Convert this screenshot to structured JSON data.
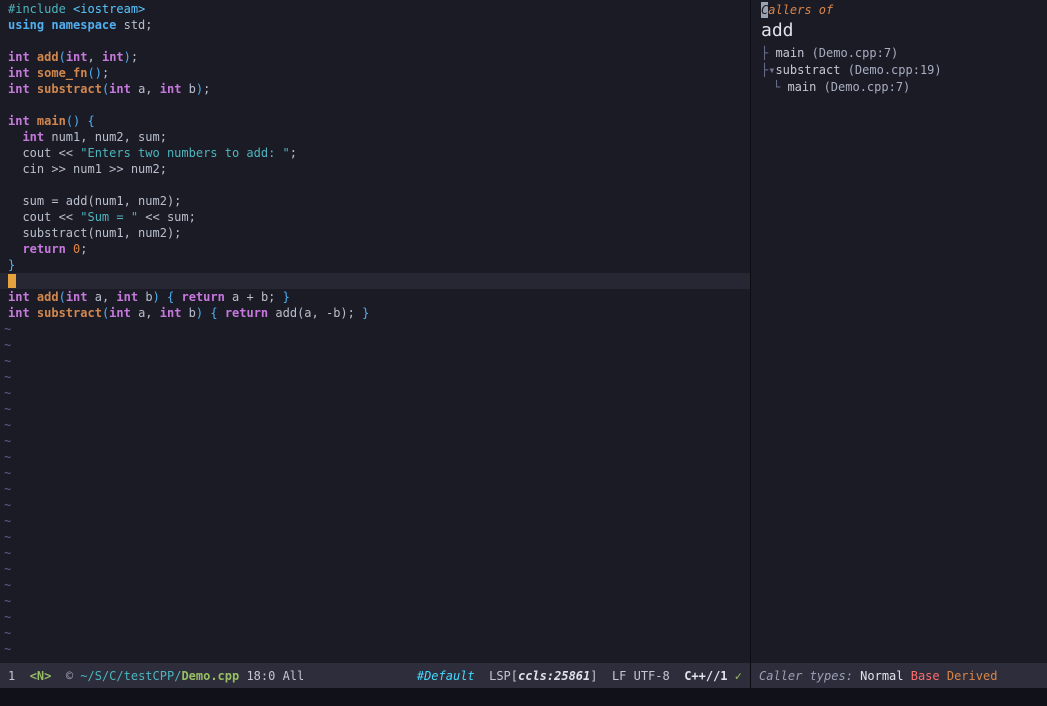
{
  "palette": {
    "bg": "#1b1b26",
    "fg": "#b8bfcc",
    "bright": "#dfe3ea",
    "purple": "#c678dd",
    "orange": "#d2874d",
    "orangenum": "#da8548",
    "blue": "#51afef",
    "teal": "#4db5bd",
    "cyanl": "#57c7ff",
    "cyan": "#46d9ff",
    "green": "#98be65",
    "red": "#ff6c6b",
    "tilde": "#565d84",
    "cursor": "#e6a23c",
    "cursorline": "#272734",
    "slbg": "#2d2d3b",
    "slfg": "#c2c7d0",
    "slicon": "#9aa0ae",
    "sllabel": "#9ba0b5",
    "title": "#da8548",
    "panelcursor": "#9aa1b0",
    "treeglyph": "#6d7390",
    "treetext": "#c3c8d2",
    "treeloc": "#a7adc0",
    "sep": "#0c0c13",
    "cmdbg": "#11111a"
  },
  "editor": {
    "cursor": {
      "line": 17,
      "col": 0,
      "position_label": "18:0"
    },
    "filler_char": "~",
    "filler_count": 21,
    "lines": [
      [
        [
          "pre",
          "#include "
        ],
        [
          "inc",
          "<iostream>"
        ]
      ],
      [
        [
          "ns",
          "using namespace"
        ],
        [
          "txt",
          " std;"
        ]
      ],
      [],
      [
        [
          "kw",
          "int "
        ],
        [
          "fn",
          "add"
        ],
        [
          "blue",
          "("
        ],
        [
          "kw",
          "int"
        ],
        [
          "txt",
          ", "
        ],
        [
          "kw",
          "int"
        ],
        [
          "blue",
          ")"
        ],
        [
          "txt",
          ";"
        ]
      ],
      [
        [
          "kw",
          "int "
        ],
        [
          "fn",
          "some_fn"
        ],
        [
          "blue",
          "()"
        ],
        [
          "txt",
          ";"
        ]
      ],
      [
        [
          "kw",
          "int "
        ],
        [
          "fn",
          "substract"
        ],
        [
          "blue",
          "("
        ],
        [
          "kw",
          "int"
        ],
        [
          "txt",
          " a, "
        ],
        [
          "kw",
          "int"
        ],
        [
          "txt",
          " b"
        ],
        [
          "blue",
          ")"
        ],
        [
          "txt",
          ";"
        ]
      ],
      [],
      [
        [
          "kw",
          "int "
        ],
        [
          "fn",
          "main"
        ],
        [
          "blue",
          "() {"
        ]
      ],
      [
        [
          "txt",
          "  "
        ],
        [
          "kw",
          "int "
        ],
        [
          "txt",
          "num1, num2, sum;"
        ]
      ],
      [
        [
          "txt",
          "  cout << "
        ],
        [
          "str",
          "\"Enters two numbers to add: \""
        ],
        [
          "txt",
          ";"
        ]
      ],
      [
        [
          "txt",
          "  cin >> num1 >> num2;"
        ]
      ],
      [],
      [
        [
          "txt",
          "  sum = add(num1, num2);"
        ]
      ],
      [
        [
          "txt",
          "  cout << "
        ],
        [
          "str",
          "\"Sum = \""
        ],
        [
          "txt",
          " << sum;"
        ]
      ],
      [
        [
          "txt",
          "  substract(num1, num2);"
        ]
      ],
      [
        [
          "txt",
          "  "
        ],
        [
          "kw",
          "return "
        ],
        [
          "num",
          "0"
        ],
        [
          "txt",
          ";"
        ]
      ],
      [
        [
          "blue",
          "}"
        ]
      ],
      [],
      [
        [
          "kw",
          "int "
        ],
        [
          "fn",
          "add"
        ],
        [
          "blue",
          "("
        ],
        [
          "kw",
          "int"
        ],
        [
          "txt",
          " a, "
        ],
        [
          "kw",
          "int"
        ],
        [
          "txt",
          " b"
        ],
        [
          "blue",
          ") { "
        ],
        [
          "kw",
          "return "
        ],
        [
          "txt",
          "a + b; "
        ],
        [
          "blue",
          "}"
        ]
      ],
      [
        [
          "kw",
          "int "
        ],
        [
          "fn",
          "substract"
        ],
        [
          "blue",
          "("
        ],
        [
          "kw",
          "int"
        ],
        [
          "txt",
          " a, "
        ],
        [
          "kw",
          "int"
        ],
        [
          "txt",
          " b"
        ],
        [
          "blue",
          ") { "
        ],
        [
          "kw",
          "return "
        ],
        [
          "txt",
          "add(a, -b); "
        ],
        [
          "blue",
          "}"
        ]
      ]
    ]
  },
  "panel": {
    "title_cursor_char": "C",
    "title_rest": "allers of",
    "symbol": "add",
    "tree": [
      {
        "glyph": "├ ",
        "name": "main",
        "loc": "(Demo.cpp:7)",
        "child": false
      },
      {
        "glyph": "├▾",
        "name": "substract",
        "loc": "(Demo.cpp:19)",
        "child": false
      },
      {
        "glyph": "└ ",
        "name": "main",
        "loc": "(Demo.cpp:7)",
        "child": true
      }
    ]
  },
  "statusline": {
    "left": [
      {
        "text": "1  ",
        "style": "fg",
        "name": "buffer-number"
      },
      {
        "text": "<N>",
        "style": "mode",
        "name": "mode-indicator"
      },
      {
        "text": "  © ",
        "style": "icon",
        "name": "file-icon"
      },
      {
        "text": "~/S/C/testCPP/",
        "style": "path",
        "name": "file-path"
      },
      {
        "text": "Demo.cpp",
        "style": "file",
        "name": "file-name"
      },
      {
        "text": " 18:0 All",
        "style": "fg",
        "name": "cursor-position"
      }
    ],
    "right": [
      {
        "text": "#Default",
        "style": "theme",
        "name": "colorscheme"
      },
      {
        "text": "  LSP[",
        "style": "fg",
        "name": "lsp-label"
      },
      {
        "text": "ccls:25861",
        "style": "lsp",
        "name": "lsp-server"
      },
      {
        "text": "]  ",
        "style": "fg",
        "name": "lsp-label-close"
      },
      {
        "text": "LF UTF-8  ",
        "style": "fg",
        "name": "encoding"
      },
      {
        "text": "C++//1",
        "style": "ft",
        "name": "filetype"
      },
      {
        "text": " ✓",
        "style": "ok",
        "name": "check-icon"
      }
    ]
  },
  "panel_statusline": [
    {
      "text": "Caller types: ",
      "style": "label",
      "name": "caller-types-label"
    },
    {
      "text": "Normal ",
      "style": "normal",
      "name": "caller-type-normal"
    },
    {
      "text": "Base ",
      "style": "base",
      "name": "caller-type-base"
    },
    {
      "text": "Derived",
      "style": "derived",
      "name": "caller-type-derived"
    }
  ]
}
